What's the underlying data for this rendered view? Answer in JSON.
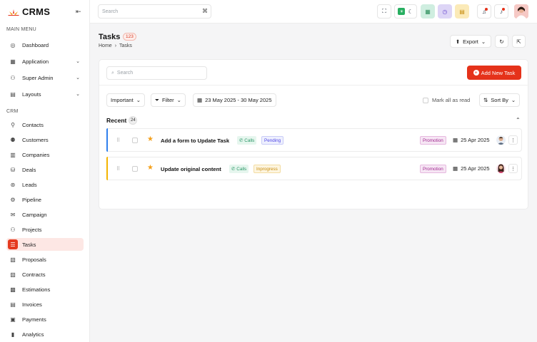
{
  "brand": {
    "name": "CRMS",
    "accent": "#e5321a"
  },
  "sidebar": {
    "main_menu_label": "MAIN MENU",
    "crm_label": "CRM",
    "main_items": [
      {
        "label": "Dashboard",
        "icon": "dashboard-icon"
      },
      {
        "label": "Application",
        "icon": "application-icon",
        "expandable": true
      },
      {
        "label": "Super Admin",
        "icon": "super-admin-icon",
        "expandable": true
      },
      {
        "label": "Layouts",
        "icon": "layouts-icon",
        "expandable": true
      }
    ],
    "crm_items": [
      {
        "label": "Contacts",
        "icon": "contacts-icon"
      },
      {
        "label": "Customers",
        "icon": "customers-icon"
      },
      {
        "label": "Companies",
        "icon": "companies-icon"
      },
      {
        "label": "Deals",
        "icon": "deals-icon"
      },
      {
        "label": "Leads",
        "icon": "leads-icon"
      },
      {
        "label": "Pipeline",
        "icon": "pipeline-icon"
      },
      {
        "label": "Campaign",
        "icon": "campaign-icon"
      },
      {
        "label": "Projects",
        "icon": "projects-icon"
      },
      {
        "label": "Tasks",
        "icon": "tasks-icon",
        "active": true
      },
      {
        "label": "Proposals",
        "icon": "proposals-icon"
      },
      {
        "label": "Contracts",
        "icon": "contracts-icon"
      },
      {
        "label": "Estimations",
        "icon": "estimations-icon"
      },
      {
        "label": "Invoices",
        "icon": "invoices-icon"
      },
      {
        "label": "Payments",
        "icon": "payments-icon"
      },
      {
        "label": "Analytics",
        "icon": "analytics-icon"
      }
    ]
  },
  "topbar": {
    "search_placeholder": "Search",
    "search_shortcut": "⌘"
  },
  "page": {
    "title": "Tasks",
    "count": "123",
    "breadcrumb": [
      "Home",
      "Tasks"
    ],
    "export_label": "Export"
  },
  "toolbar": {
    "search_placeholder": "Search",
    "add_label": "Add New Task",
    "filters": {
      "sort_select": "Important",
      "filter_label": "Filter",
      "date_range": "23 May 2025 - 30 May 2025"
    },
    "mark_all_label": "Mark all as read",
    "sort_by_label": "Sort By"
  },
  "recent": {
    "label": "Recent",
    "count": "24",
    "tasks": [
      {
        "title": "Add a form to Update Task",
        "tag": "Calls",
        "status": "Pending",
        "status_color": "#4f46e5",
        "category": "Promotion",
        "date": "25 Apr 2025",
        "accent": "#2f80ed"
      },
      {
        "title": "Update original content",
        "tag": "Calls",
        "status": "Inprogress",
        "status_color": "#e0a21b",
        "category": "Promotion",
        "date": "25 Apr 2025",
        "accent": "#f4b400"
      }
    ]
  }
}
